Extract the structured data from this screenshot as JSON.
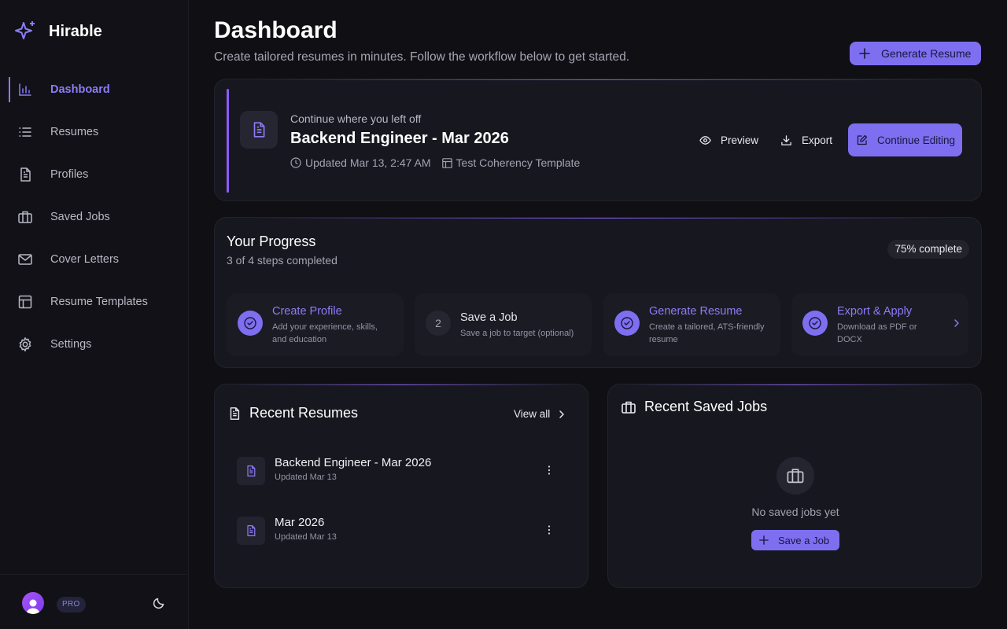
{
  "app": {
    "name": "Hirable"
  },
  "sidebar": {
    "items": [
      {
        "label": "Dashboard",
        "icon": "bar-chart-icon",
        "active": true
      },
      {
        "label": "Resumes",
        "icon": "list-icon"
      },
      {
        "label": "Profiles",
        "icon": "file-text-icon"
      },
      {
        "label": "Saved Jobs",
        "icon": "briefcase-icon"
      },
      {
        "label": "Cover Letters",
        "icon": "mail-icon"
      },
      {
        "label": "Resume Templates",
        "icon": "layout-icon"
      },
      {
        "label": "Settings",
        "icon": "gear-icon"
      }
    ],
    "footer": {
      "badge": "PRO"
    }
  },
  "header": {
    "title": "Dashboard",
    "subtitle": "Create tailored resumes in minutes. Follow the workflow below to get started.",
    "generate_label": "Generate Resume"
  },
  "continue": {
    "label": "Continue where you left off",
    "title": "Backend Engineer - Mar 2026",
    "updated": "Updated Mar 13, 2:47 AM",
    "template": "Test Coherency Template",
    "preview_label": "Preview",
    "export_label": "Export",
    "continue_label": "Continue Editing"
  },
  "progress": {
    "title": "Your Progress",
    "subtitle": "3 of 4 steps completed",
    "badge": "75% complete",
    "steps": [
      {
        "title": "Create Profile",
        "desc": "Add your experience, skills, and education",
        "done": true
      },
      {
        "title": "Save a Job",
        "desc": "Save a job to target (optional)",
        "number": "2",
        "done": false
      },
      {
        "title": "Generate Resume",
        "desc": "Create a tailored, ATS-friendly resume",
        "done": true
      },
      {
        "title": "Export & Apply",
        "desc": "Download as PDF or DOCX",
        "done": true
      }
    ]
  },
  "recent_resumes": {
    "title": "Recent Resumes",
    "view_all": "View all",
    "items": [
      {
        "name": "Backend Engineer - Mar 2026",
        "updated": "Updated Mar 13"
      },
      {
        "name": "Mar 2026",
        "updated": "Updated Mar 13"
      }
    ]
  },
  "recent_jobs": {
    "title": "Recent Saved Jobs",
    "empty_text": "No saved jobs yet",
    "save_label": "Save a Job"
  },
  "colors": {
    "accent": "#7e6ff0",
    "background": "#0f0f14",
    "card": "#17171f"
  }
}
